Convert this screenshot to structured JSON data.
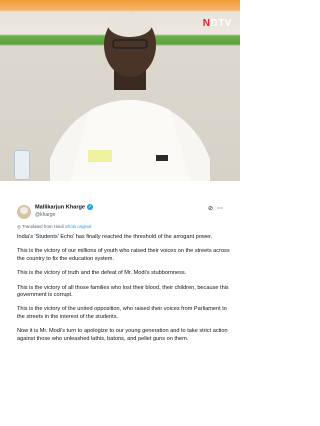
{
  "media": {
    "watermark_n": "N",
    "watermark_rest": "DTV",
    "alt": "Photo of Mallikarjun Kharge"
  },
  "tweet": {
    "author_name": "Mallikarjun Kharge",
    "author_handle": "@kharge",
    "verified_mark": "✓",
    "translated_text": "Translated from Hindi",
    "show_original": "Show original",
    "paragraphs": [
      "India's 'Students' Echo' has finally reached the threshold of the arrogant power.",
      "This is the victory of our millions of youth who raised their voices on the streets across the country to fix the education system.",
      "This is the victory of truth and the defeat of Mr. Modi's stubbornness.",
      "This is the victory of all those families who lost their blood, their children, because this government is corrupt.",
      "This is the victory of the united opposition, who raised their voices from Parliament to the streets in the interest of the students.",
      "Now it is Mr. Modi's turn to apologize to our young generation and to take strict action against those who unleashed lathis, batons, and pellet guns on them."
    ]
  },
  "icons": {
    "grok": "grok-icon",
    "more": "more-icon",
    "globe": "globe-icon"
  },
  "colors": {
    "link": "#1d9bf0",
    "secondary_text": "#536471",
    "saffron": "#f29a3a",
    "green": "#5aa13c"
  }
}
